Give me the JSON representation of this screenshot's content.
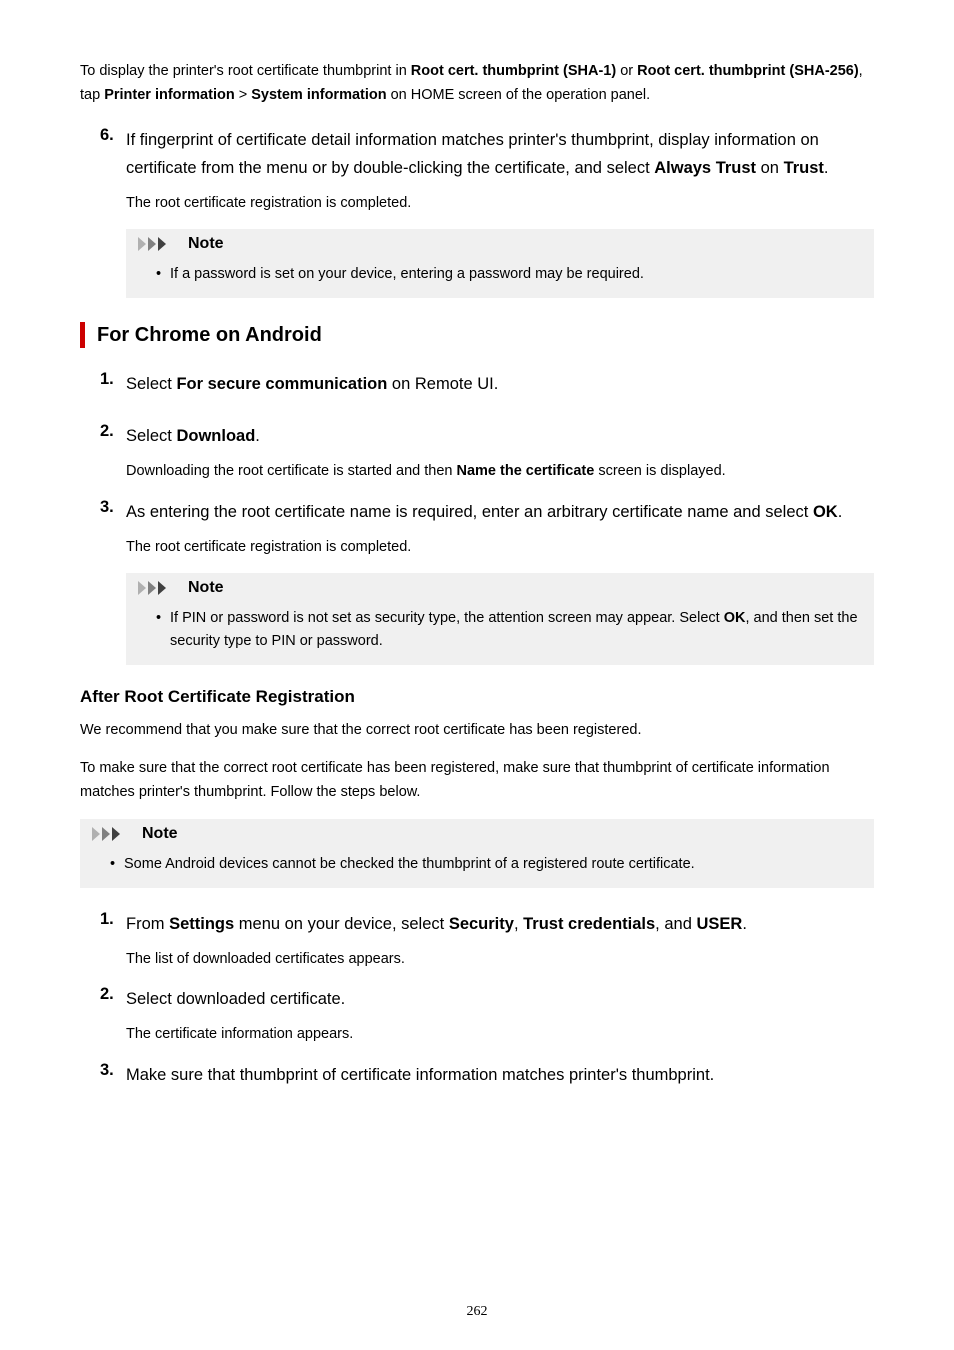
{
  "topPara": {
    "p1": "To display the printer's root certificate thumbprint in ",
    "b1": "Root cert. thumbprint (SHA-1)",
    "p2": " or ",
    "b2": "Root cert. thumbprint (SHA-256)",
    "p3": ", tap ",
    "b3": "Printer information",
    "p4": " > ",
    "b4": "System information",
    "p5": " on HOME screen of the operation panel."
  },
  "step6": {
    "num": "6.",
    "t1": "If fingerprint of certificate detail information matches printer's thumbprint, display information on certificate from the menu or by double-clicking the certificate, and select ",
    "b1": "Always Trust",
    "t2": " on ",
    "b2": "Trust",
    "t3": ".",
    "sub": "The root certificate registration is completed."
  },
  "noteLabel": "Note",
  "note1": {
    "item": "If a password is set on your device, entering a password may be required."
  },
  "sectionTitle": "For Chrome on Android",
  "a_step1": {
    "num": "1.",
    "t1": "Select ",
    "b1": "For secure communication",
    "t2": " on Remote UI."
  },
  "a_step2": {
    "num": "2.",
    "t1": "Select ",
    "b1": "Download",
    "t2": ".",
    "sub1": "Downloading the root certificate is started and then ",
    "subB": "Name the certificate",
    "sub2": " screen is displayed."
  },
  "a_step3": {
    "num": "3.",
    "t1": "As entering the root certificate name is required, enter an arbitrary certificate name and select ",
    "b1": "OK",
    "t2": ".",
    "sub": "The root certificate registration is completed."
  },
  "note2": {
    "i1": "If PIN or password is not set as security type, the attention screen may appear. Select ",
    "b1": "OK",
    "i2": ", and then set the security type to PIN or password."
  },
  "afterTitle": "After Root Certificate Registration",
  "afterP1": "We recommend that you make sure that the correct root certificate has been registered.",
  "afterP2": "To make sure that the correct root certificate has been registered, make sure that thumbprint of certificate information matches printer's thumbprint. Follow the steps below.",
  "note3": {
    "item": "Some Android devices cannot be checked the thumbprint of a registered route certificate."
  },
  "b_step1": {
    "num": "1.",
    "t1": "From ",
    "b1": "Settings",
    "t2": " menu on your device, select ",
    "b2": "Security",
    "t3": ", ",
    "b3": "Trust credentials",
    "t4": ", and ",
    "b4": "USER",
    "t5": ".",
    "sub": "The list of downloaded certificates appears."
  },
  "b_step2": {
    "num": "2.",
    "t1": "Select downloaded certificate.",
    "sub": "The certificate information appears."
  },
  "b_step3": {
    "num": "3.",
    "t1": "Make sure that thumbprint of certificate information matches printer's thumbprint."
  },
  "pageNum": "262"
}
